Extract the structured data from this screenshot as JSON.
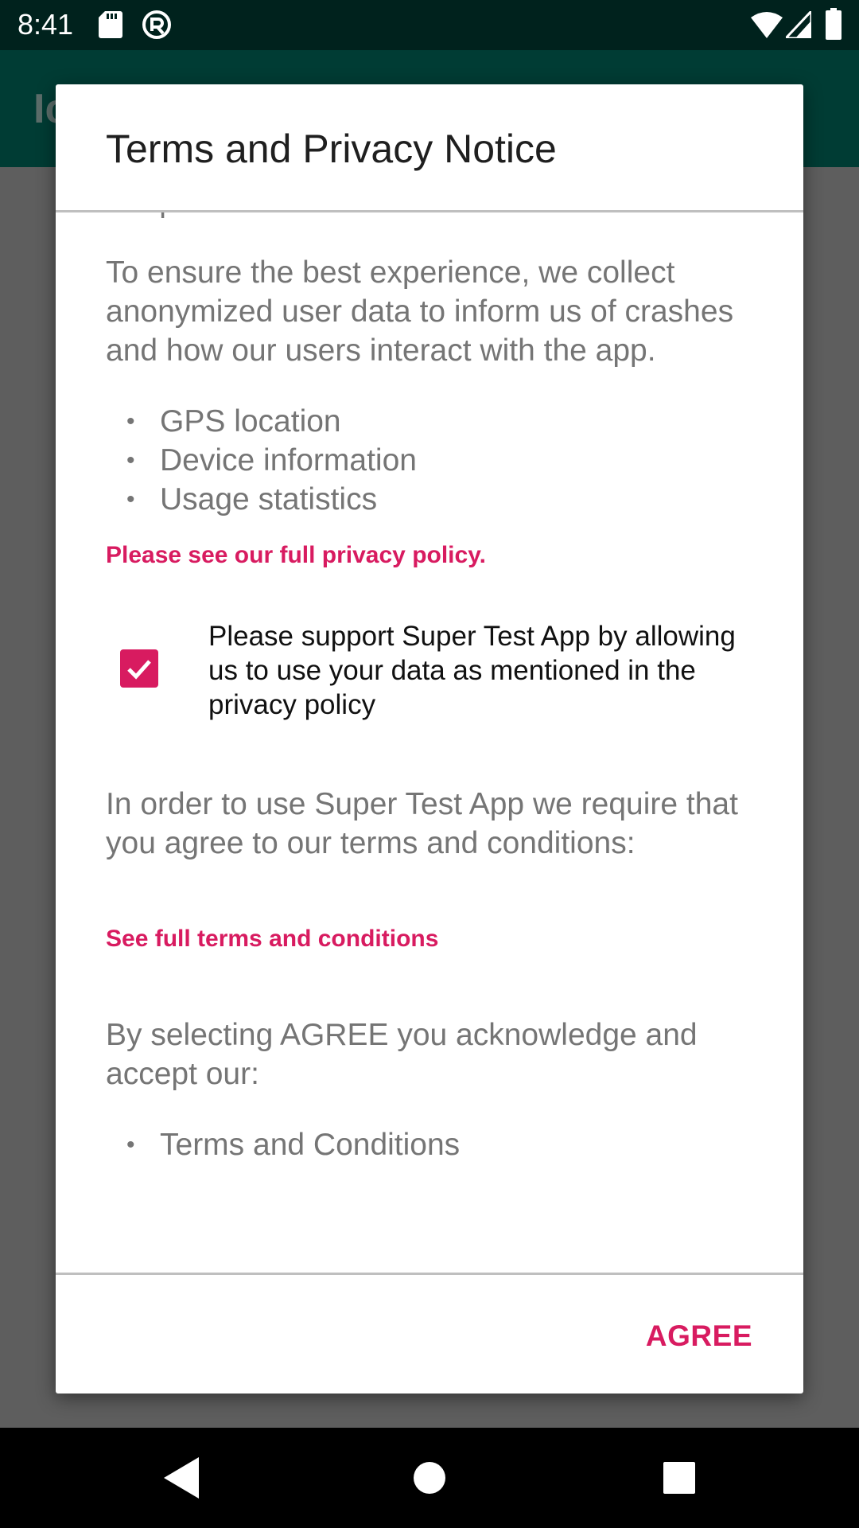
{
  "status_bar": {
    "time": "8:41",
    "icons": [
      "sdcard-icon",
      "notification-icon",
      "wifi-icon",
      "signal-icon",
      "battery-icon"
    ]
  },
  "app_bar": {
    "title_partial": "Ic"
  },
  "dialog": {
    "title": "Terms and Privacy Notice",
    "partial_text": "our policies",
    "intro_paragraph": "To ensure the best experience, we collect anonymized user data to inform us of crashes and how our users interact with the app.",
    "data_items": [
      "GPS location",
      "Device information",
      "Usage statistics"
    ],
    "privacy_link": "Please see our full privacy policy.",
    "consent": {
      "checked": true,
      "label": "Please support Super Test App by allowing us to use your data as mentioned in the privacy policy"
    },
    "terms_paragraph": "In order to use Super Test App we require that you agree to our terms and conditions:",
    "terms_link": "See full terms and conditions",
    "acknowledge_paragraph": "By selecting AGREE you acknowledge and accept our:",
    "accept_items": [
      "Terms and Conditions"
    ],
    "agree_label": "AGREE"
  },
  "nav_bar": {
    "icons": [
      "back-icon",
      "home-icon",
      "recents-icon"
    ]
  },
  "colors": {
    "accent": "#d81b60",
    "status_bar": "#00221d",
    "app_bar": "#003c34",
    "scrim": "#5e5e5e",
    "body_text": "#757575"
  }
}
